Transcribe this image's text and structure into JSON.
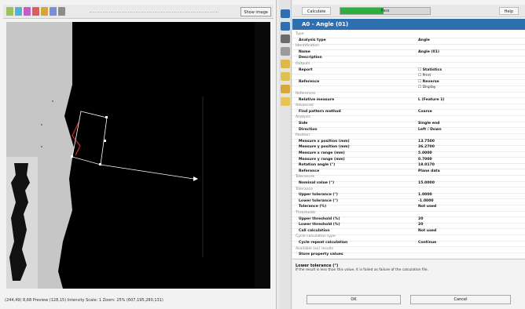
{
  "viewer": {
    "show_image_label": "Show image",
    "status_text": "(244,49) 8,68 Preview  (128,15) Intensity  Scale: 1  Zoom: 25%  (607,195,280,131)"
  },
  "run": {
    "label": "Calculate",
    "progress_text": "Pass",
    "progress_fraction": 0.48,
    "help_label": "Help"
  },
  "panel": {
    "title": "A0 - Angle (01)"
  },
  "properties": [
    {
      "name": "Type",
      "value": "",
      "kind": "cat"
    },
    {
      "name": "Analysis type",
      "value": "Angle",
      "kind": "bold"
    },
    {
      "name": "Identification",
      "value": "",
      "kind": "cat"
    },
    {
      "name": "Name",
      "value": "Angle (01)",
      "kind": "bold"
    },
    {
      "name": "Description",
      "value": "",
      "kind": "bold"
    },
    {
      "name": "Outputs",
      "value": "",
      "kind": "cat"
    },
    {
      "name": "Report",
      "value": "☐ Statistics",
      "kind": "bold"
    },
    {
      "name": "",
      "value": "☐ Print",
      "kind": "normal"
    },
    {
      "name": "Reference",
      "value": "☐ Reverse",
      "kind": "bold"
    },
    {
      "name": "",
      "value": "☐ Display",
      "kind": "normal"
    },
    {
      "name": "References",
      "value": "",
      "kind": "cat"
    },
    {
      "name": "Relative measure",
      "value": "L (Feature 1)",
      "kind": "bold"
    },
    {
      "name": "Advanced",
      "value": "",
      "kind": "cat"
    },
    {
      "name": "Find pattern method",
      "value": "Coarse",
      "kind": "bold"
    },
    {
      "name": "Analysis",
      "value": "",
      "kind": "cat"
    },
    {
      "name": "Side",
      "value": "Single end",
      "kind": "bold"
    },
    {
      "name": "Direction",
      "value": "Left / Down",
      "kind": "bold"
    },
    {
      "name": "Position",
      "value": "",
      "kind": "cat"
    },
    {
      "name": "Measure x position (mm)",
      "value": "13.7500",
      "kind": "bold"
    },
    {
      "name": "Measure y position (mm)",
      "value": "36.2700",
      "kind": "bold"
    },
    {
      "name": "Measure x range (mm)",
      "value": "5.0000",
      "kind": "bold"
    },
    {
      "name": "Measure y range (mm)",
      "value": "0.7000",
      "kind": "bold"
    },
    {
      "name": "Rotation angle (°)",
      "value": "18.0170",
      "kind": "bold"
    },
    {
      "name": "Reference",
      "value": "Plane data",
      "kind": "bold"
    },
    {
      "name": "Tolerances",
      "value": "",
      "kind": "cat"
    },
    {
      "name": "Nominal value (°)",
      "value": "15.0000",
      "kind": "bold"
    },
    {
      "name": "Tolerance",
      "value": "",
      "kind": "cat"
    },
    {
      "name": "Upper tolerance (°)",
      "value": "1.0000",
      "kind": "bold"
    },
    {
      "name": "Lower tolerance (°)",
      "value": "-1.0000",
      "kind": "bold"
    },
    {
      "name": "Tolerance (%)",
      "value": "Not used",
      "kind": "bold"
    },
    {
      "name": "Thresholds",
      "value": "",
      "kind": "cat"
    },
    {
      "name": "Upper threshold (%)",
      "value": "20",
      "kind": "bold"
    },
    {
      "name": "Lower threshold (%)",
      "value": "20",
      "kind": "bold"
    },
    {
      "name": "Call calculation",
      "value": "Not used",
      "kind": "bold"
    },
    {
      "name": "Cycle calculation type",
      "value": "",
      "kind": "cat"
    },
    {
      "name": "Cycle repeat calculation",
      "value": "Continue",
      "kind": "bold"
    },
    {
      "name": "Available (ex) results",
      "value": "",
      "kind": "cat"
    },
    {
      "name": "Store property values",
      "value": "",
      "kind": "bold"
    }
  ],
  "description": {
    "title": "Lower tolerance (°)",
    "text": "If the result is less than this value, it is failed as failure of the calculation file."
  },
  "buttons": {
    "ok": "OK",
    "cancel": "Cancel"
  },
  "colors": {
    "title_bar": "#2f6fb0",
    "progress": "#2fae3d",
    "overlay_line": "#ffffff",
    "feature_red": "#d92a2a"
  },
  "icons": {
    "toolbar": [
      "pointer-icon",
      "zoom-icon",
      "pan-icon",
      "measure-icon",
      "color-icon",
      "fit-icon",
      "settings-icon"
    ],
    "strip": [
      "eye-icon",
      "eye-icon",
      "undo-icon",
      "camera-icon",
      "image-icon",
      "folder-icon",
      "chart-icon",
      "layers-icon"
    ]
  }
}
